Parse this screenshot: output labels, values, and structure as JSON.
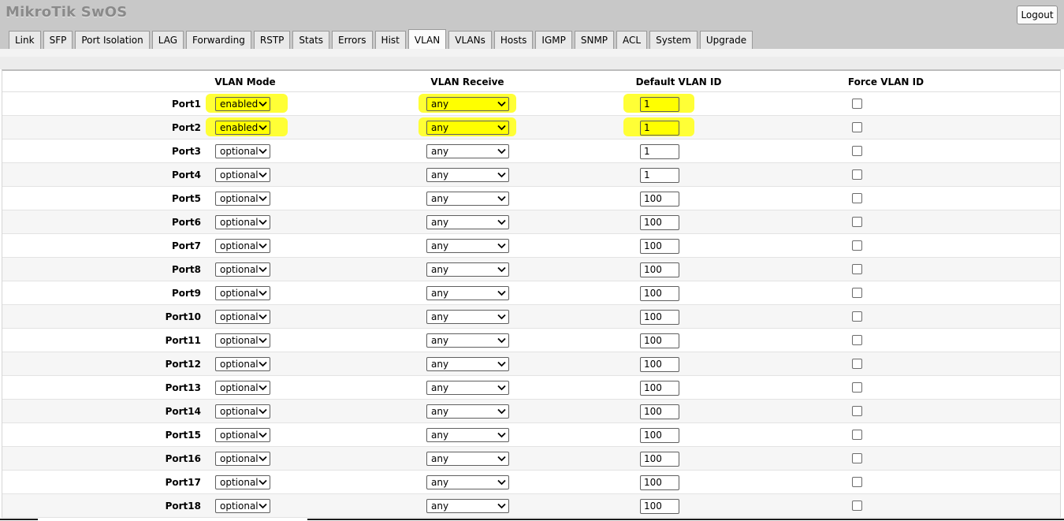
{
  "app": {
    "title": "MikroTik SwOS",
    "logout_label": "Logout"
  },
  "tabs": [
    "Link",
    "SFP",
    "Port Isolation",
    "LAG",
    "Forwarding",
    "RSTP",
    "Stats",
    "Errors",
    "Hist",
    "VLAN",
    "VLANs",
    "Hosts",
    "IGMP",
    "SNMP",
    "ACL",
    "System",
    "Upgrade"
  ],
  "active_tab": "VLAN",
  "columns": {
    "mode": "VLAN Mode",
    "receive": "VLAN Receive",
    "default_id": "Default VLAN ID",
    "force": "Force VLAN ID"
  },
  "highlight_color": "#ffff00",
  "rows": [
    {
      "port": "Port1",
      "mode": "enabled",
      "receive": "any",
      "default_id": "1",
      "force": false,
      "highlighted": true
    },
    {
      "port": "Port2",
      "mode": "enabled",
      "receive": "any",
      "default_id": "1",
      "force": false,
      "highlighted": true
    },
    {
      "port": "Port3",
      "mode": "optional",
      "receive": "any",
      "default_id": "1",
      "force": false
    },
    {
      "port": "Port4",
      "mode": "optional",
      "receive": "any",
      "default_id": "1",
      "force": false
    },
    {
      "port": "Port5",
      "mode": "optional",
      "receive": "any",
      "default_id": "100",
      "force": false
    },
    {
      "port": "Port6",
      "mode": "optional",
      "receive": "any",
      "default_id": "100",
      "force": false
    },
    {
      "port": "Port7",
      "mode": "optional",
      "receive": "any",
      "default_id": "100",
      "force": false
    },
    {
      "port": "Port8",
      "mode": "optional",
      "receive": "any",
      "default_id": "100",
      "force": false
    },
    {
      "port": "Port9",
      "mode": "optional",
      "receive": "any",
      "default_id": "100",
      "force": false
    },
    {
      "port": "Port10",
      "mode": "optional",
      "receive": "any",
      "default_id": "100",
      "force": false
    },
    {
      "port": "Port11",
      "mode": "optional",
      "receive": "any",
      "default_id": "100",
      "force": false
    },
    {
      "port": "Port12",
      "mode": "optional",
      "receive": "any",
      "default_id": "100",
      "force": false
    },
    {
      "port": "Port13",
      "mode": "optional",
      "receive": "any",
      "default_id": "100",
      "force": false
    },
    {
      "port": "Port14",
      "mode": "optional",
      "receive": "any",
      "default_id": "100",
      "force": false
    },
    {
      "port": "Port15",
      "mode": "optional",
      "receive": "any",
      "default_id": "100",
      "force": false
    },
    {
      "port": "Port16",
      "mode": "optional",
      "receive": "any",
      "default_id": "100",
      "force": false
    },
    {
      "port": "Port17",
      "mode": "optional",
      "receive": "any",
      "default_id": "100",
      "force": false
    },
    {
      "port": "Port18",
      "mode": "optional",
      "receive": "any",
      "default_id": "100",
      "force": false
    }
  ]
}
